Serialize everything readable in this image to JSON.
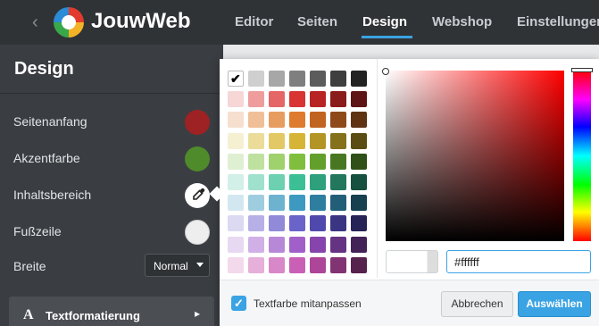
{
  "nav": {
    "back_icon": "chevron-left-icon",
    "brand": "JouwWeb",
    "items": [
      {
        "label": "Editor"
      },
      {
        "label": "Seiten"
      },
      {
        "label": "Design",
        "active": true
      },
      {
        "label": "Webshop"
      },
      {
        "label": "Einstellungen"
      }
    ]
  },
  "sidebar": {
    "title": "Design",
    "rows": [
      {
        "label": "Seitenanfang",
        "color": "#9e2223"
      },
      {
        "label": "Akzentfarbe",
        "color": "#4f8a2b"
      },
      {
        "label": "Inhaltsbereich",
        "icon": "eyedropper-icon"
      },
      {
        "label": "Fußzeile",
        "color": "#eeeeee"
      }
    ],
    "width_label": "Breite",
    "width_value": "Normal",
    "text_section": {
      "glyph": "A",
      "label": "Textformatierung"
    }
  },
  "picker": {
    "palette": [
      [
        "#ffffff",
        "#cfcfcf",
        "#a7a7a7",
        "#7f7f7f",
        "#5c5c5c",
        "#3f3f3f",
        "#222222"
      ],
      [
        "#f7d6d6",
        "#ef9c9c",
        "#e46666",
        "#d83434",
        "#b82323",
        "#8a1c1c",
        "#5e1414"
      ],
      [
        "#f6dfcf",
        "#f0bf97",
        "#e89d60",
        "#de7b2e",
        "#c06420",
        "#8e4a19",
        "#5f3312"
      ],
      [
        "#f6f0d2",
        "#ecdc9a",
        "#e2c965",
        "#d6b536",
        "#b39525",
        "#85701c",
        "#5a4c13"
      ],
      [
        "#dff0d2",
        "#bfe19f",
        "#9fd16d",
        "#7fbf3d",
        "#63a02b",
        "#487722",
        "#2f5016"
      ],
      [
        "#d2f0e7",
        "#9fe1cc",
        "#6dd0b1",
        "#3dbf96",
        "#2ea07c",
        "#22775c",
        "#16503e"
      ],
      [
        "#d2e7f0",
        "#9fcde0",
        "#6db3d0",
        "#3d99bf",
        "#2e7ea0",
        "#225e77",
        "#163f50"
      ],
      [
        "#dcd9f3",
        "#b6b0e6",
        "#908ad8",
        "#6a63c9",
        "#5049ad",
        "#3a3582",
        "#262357"
      ],
      [
        "#e8d9f3",
        "#d0b0e6",
        "#b888d8",
        "#a160c9",
        "#8645ad",
        "#643382",
        "#432257"
      ],
      [
        "#f3d9ec",
        "#e6b0da",
        "#d888c8",
        "#c960b5",
        "#ad4599",
        "#823373",
        "#57224d"
      ]
    ],
    "selected": {
      "row": 0,
      "col": 0
    },
    "hue": 0,
    "saturation": 0,
    "brightness": 1,
    "hex_value": "#ffffff",
    "preview_color": "#ffffff",
    "checkbox_label": "Textfarbe mitanpassen",
    "checkbox_checked": true,
    "cancel_label": "Abbrechen",
    "ok_label": "Auswählen"
  }
}
